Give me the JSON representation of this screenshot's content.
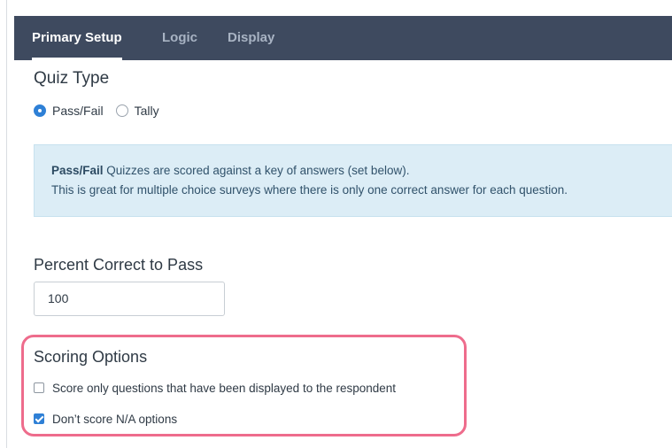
{
  "tabs": [
    {
      "label": "Primary Setup",
      "active": true
    },
    {
      "label": "Logic",
      "active": false
    },
    {
      "label": "Display",
      "active": false
    }
  ],
  "quiz_type": {
    "title": "Quiz Type",
    "options": [
      {
        "label": "Pass/Fail",
        "selected": true
      },
      {
        "label": "Tally",
        "selected": false
      }
    ]
  },
  "info": {
    "bold": "Pass/Fail",
    "line1_rest": " Quizzes are scored against a key of answers (set below).",
    "line2": "This is great for multiple choice surveys where there is only one correct answer for each question."
  },
  "percent": {
    "title": "Percent Correct to Pass",
    "value": "100"
  },
  "scoring": {
    "title": "Scoring Options",
    "options": [
      {
        "label": "Score only questions that have been displayed to the respondent",
        "checked": false
      },
      {
        "label": "Don’t score N/A options",
        "checked": true
      }
    ]
  },
  "colors": {
    "topbar": "#3e4a5f",
    "accent": "#2f80d6",
    "info_bg": "#dcedf6",
    "highlight": "#ee6c8c"
  }
}
